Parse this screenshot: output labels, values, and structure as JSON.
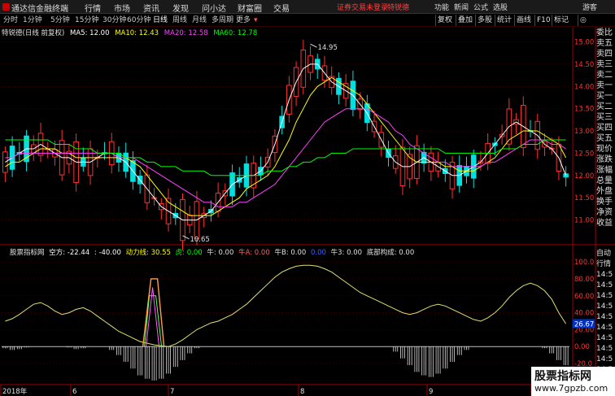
{
  "window": {
    "app_title": "通达信金融终端",
    "menus": [
      "行情",
      "市场",
      "资讯",
      "发现",
      "问小达",
      "财富圈",
      "交易"
    ],
    "warning": "证券交易未登录",
    "stock_name": "特锐德",
    "right_menus": [
      "功能",
      "新闻",
      "公式",
      "选股",
      "游客"
    ]
  },
  "toolbar": {
    "periods": [
      "分时",
      "1分钟",
      "5分钟",
      "15分钟",
      "30分钟",
      "60分钟",
      "日线",
      "周线",
      "月线",
      "多周期",
      "更多"
    ],
    "active_period": "日线",
    "more_arrow": "▾",
    "right_buttons": [
      "复权",
      "叠加",
      "多股",
      "统计",
      "画线",
      "F10",
      "标记",
      "◎"
    ]
  },
  "main_info": {
    "title": "特锐德(日线 前复权)",
    "ma5": "MA5: 12.00",
    "ma10": "MA10: 12.43",
    "ma20": "MA20: 12.58",
    "ma60": "MA60: 12.78"
  },
  "indicator_info": {
    "title": "股票指标网",
    "kongfang": "空方: -22.44",
    "colon": ": -40.00",
    "dongli": "动力线: 30.55",
    "hu": "虎: 0.00",
    "niu": "牛: 0.00",
    "niuA": "牛A: 0.00",
    "niuB": "牛B: 0.00",
    "blank": "0.00",
    "niu3": "牛3: 0.00",
    "dibu": "底部构成: 0.00"
  },
  "right_panel": {
    "labels": [
      "委比",
      "卖五",
      "卖四",
      "卖三",
      "卖二",
      "卖一",
      "买一",
      "买二",
      "买三",
      "买四",
      "买五",
      "现价",
      "涨跌",
      "涨幅",
      "总量",
      "外盘",
      "换手",
      "净资",
      "收益"
    ],
    "labels2": [
      "自动",
      "行情",
      "14:5",
      "14:5",
      "14:5",
      "14:5",
      "14:5",
      "14:5",
      "14:5",
      "14:5",
      "14:5",
      "14:5",
      "14:5"
    ]
  },
  "watermark": {
    "line1": "股票指标网",
    "line2": "www.7gpzb.com"
  },
  "colors": {
    "up": "#ff3030",
    "down": "#00e0e0",
    "ma5": "#ffffff",
    "ma10": "#ffff00",
    "ma20": "#ff40ff",
    "ma60": "#00ff00",
    "indicator_line": "#e0e070",
    "grid": "#700000"
  },
  "chart_data": [
    {
      "type": "candlestick",
      "title": "特锐德(日线 前复权)",
      "y_ticks": [
        "15.00",
        "14.50",
        "14.00",
        "13.50",
        "13.00",
        "12.50",
        "12.00",
        "11.50",
        "11.00"
      ],
      "ylim": [
        10.5,
        15.1
      ],
      "x_labels": [
        "2018年",
        "6",
        "7",
        "8",
        "9",
        "10"
      ],
      "high_marker": "14.95",
      "low_marker": "10.65",
      "series": [
        {
          "name": "MA5",
          "values": [
            12.3,
            12.4,
            12.5,
            12.6,
            12.6,
            12.7,
            12.6,
            12.5,
            12.4,
            12.4,
            12.3,
            12.3,
            12.3,
            12.4,
            12.5,
            12.5,
            12.4,
            12.3,
            12.1,
            11.9,
            11.7,
            11.5,
            11.3,
            11.2,
            11.1,
            11.0,
            11.0,
            11.0,
            11.1,
            11.2,
            11.4,
            11.6,
            11.8,
            11.9,
            12.0,
            12.0,
            12.1,
            12.3,
            12.7,
            13.2,
            13.7,
            14.1,
            14.4,
            14.5,
            14.5,
            14.3,
            14.1,
            14.0,
            13.9,
            13.8,
            13.6,
            13.4,
            13.1,
            12.8,
            12.5,
            12.3,
            12.2,
            12.2,
            12.3,
            12.4,
            12.3,
            12.2,
            12.1,
            12.0,
            12.0,
            12.1,
            12.2,
            12.3,
            12.5,
            12.7,
            12.9,
            13.1,
            13.2,
            13.1,
            13.0,
            12.9,
            12.7,
            12.6,
            12.4,
            12.0
          ]
        },
        {
          "name": "MA10",
          "values": [
            12.2,
            12.3,
            12.3,
            12.4,
            12.5,
            12.6,
            12.6,
            12.6,
            12.5,
            12.5,
            12.4,
            12.4,
            12.4,
            12.4,
            12.4,
            12.4,
            12.4,
            12.4,
            12.3,
            12.2,
            12.0,
            11.8,
            11.6,
            11.4,
            11.3,
            11.2,
            11.1,
            11.1,
            11.1,
            11.1,
            11.2,
            11.3,
            11.4,
            11.5,
            11.7,
            11.8,
            11.9,
            12.0,
            12.2,
            12.5,
            12.8,
            13.2,
            13.5,
            13.8,
            14.0,
            14.1,
            14.2,
            14.1,
            14.0,
            13.9,
            13.8,
            13.6,
            13.4,
            13.2,
            13.0,
            12.8,
            12.6,
            12.4,
            12.3,
            12.3,
            12.3,
            12.3,
            12.2,
            12.2,
            12.1,
            12.1,
            12.1,
            12.2,
            12.3,
            12.4,
            12.6,
            12.8,
            12.9,
            13.0,
            13.0,
            13.0,
            12.9,
            12.8,
            12.7,
            12.4
          ]
        },
        {
          "name": "MA20",
          "values": [
            12.4,
            12.4,
            12.5,
            12.5,
            12.5,
            12.5,
            12.5,
            12.5,
            12.5,
            12.5,
            12.5,
            12.5,
            12.5,
            12.5,
            12.5,
            12.5,
            12.4,
            12.4,
            12.4,
            12.3,
            12.2,
            12.1,
            12.0,
            11.9,
            11.8,
            11.7,
            11.6,
            11.5,
            11.4,
            11.4,
            11.3,
            11.3,
            11.3,
            11.4,
            11.4,
            11.5,
            11.6,
            11.7,
            11.8,
            12.0,
            12.2,
            12.4,
            12.6,
            12.8,
            13.0,
            13.2,
            13.3,
            13.4,
            13.5,
            13.5,
            13.5,
            13.5,
            13.4,
            13.3,
            13.2,
            13.0,
            12.9,
            12.7,
            12.6,
            12.5,
            12.4,
            12.3,
            12.3,
            12.2,
            12.2,
            12.2,
            12.2,
            12.2,
            12.3,
            12.3,
            12.4,
            12.5,
            12.6,
            12.7,
            12.8,
            12.8,
            12.8,
            12.7,
            12.7,
            12.6
          ]
        },
        {
          "name": "MA60",
          "values": [
            12.8,
            12.8,
            12.8,
            12.8,
            12.8,
            12.8,
            12.8,
            12.7,
            12.7,
            12.7,
            12.6,
            12.6,
            12.6,
            12.5,
            12.5,
            12.5,
            12.5,
            12.4,
            12.4,
            12.4,
            12.3,
            12.3,
            12.2,
            12.2,
            12.2,
            12.1,
            12.1,
            12.1,
            12.1,
            12.0,
            12.0,
            12.0,
            12.0,
            12.0,
            12.0,
            12.0,
            12.0,
            12.1,
            12.1,
            12.1,
            12.2,
            12.2,
            12.3,
            12.3,
            12.4,
            12.4,
            12.5,
            12.5,
            12.5,
            12.6,
            12.6,
            12.6,
            12.6,
            12.6,
            12.6,
            12.6,
            12.6,
            12.6,
            12.6,
            12.6,
            12.6,
            12.6,
            12.5,
            12.5,
            12.5,
            12.5,
            12.5,
            12.5,
            12.5,
            12.5,
            12.6,
            12.6,
            12.6,
            12.7,
            12.7,
            12.7,
            12.8,
            12.8,
            12.8,
            12.8
          ]
        }
      ]
    },
    {
      "type": "line",
      "title": "股票指标网",
      "y_ticks": [
        "100.0",
        "80.00",
        "60.00",
        "40.00",
        "20.00",
        "0.00",
        "-20.0",
        "-40.0"
      ],
      "ylim": [
        -44,
        104
      ],
      "current_value": "26.67",
      "series": [
        {
          "name": "动力线",
          "values": [
            30,
            33,
            38,
            44,
            50,
            52,
            48,
            42,
            38,
            40,
            44,
            46,
            42,
            36,
            30,
            24,
            18,
            14,
            10,
            6,
            4,
            2,
            1,
            0,
            3,
            8,
            14,
            20,
            24,
            28,
            30,
            34,
            38,
            44,
            50,
            58,
            66,
            74,
            82,
            88,
            92,
            95,
            96,
            96,
            95,
            92,
            88,
            82,
            76,
            70,
            64,
            60,
            56,
            52,
            48,
            44,
            40,
            38,
            40,
            44,
            48,
            50,
            48,
            44,
            40,
            36,
            32,
            30,
            34,
            40,
            48,
            58,
            66,
            72,
            75,
            72,
            66,
            56,
            40,
            27
          ]
        },
        {
          "name": "空方",
          "values": [
            -2,
            -4,
            -3,
            -1,
            0,
            0,
            0,
            0,
            0,
            -1,
            -3,
            -2,
            0,
            0,
            0,
            -4,
            -10,
            -18,
            -26,
            -34,
            -38,
            -40,
            -38,
            -32,
            -24,
            -16,
            -8,
            -2,
            0,
            0,
            0,
            0,
            0,
            0,
            0,
            0,
            0,
            0,
            0,
            0,
            0,
            0,
            0,
            0,
            0,
            0,
            0,
            0,
            0,
            0,
            0,
            0,
            0,
            0,
            0,
            -6,
            -14,
            -22,
            -30,
            -34,
            -36,
            -32,
            -26,
            -18,
            -10,
            -4,
            0,
            0,
            0,
            0,
            0,
            0,
            0,
            0,
            0,
            0,
            -2,
            -8,
            -16,
            -22
          ]
        }
      ]
    }
  ]
}
